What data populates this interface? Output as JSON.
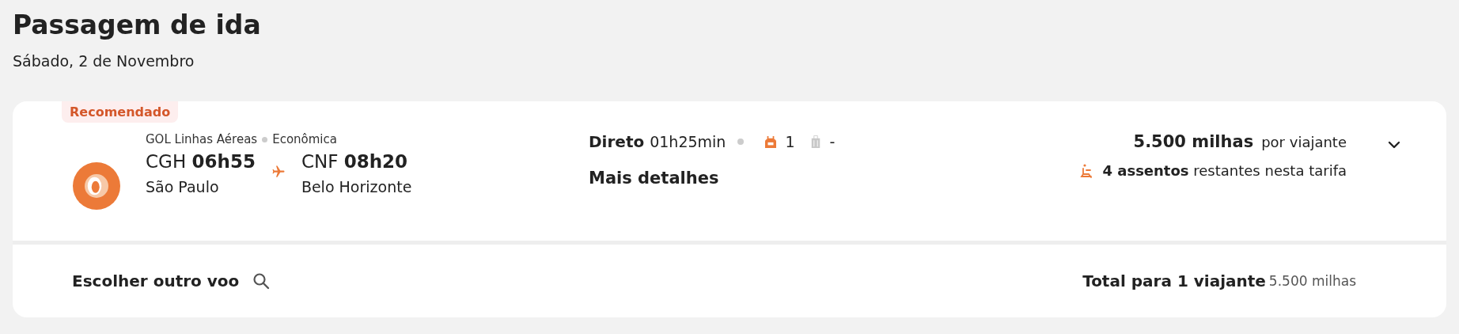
{
  "header": {
    "title": "Passagem de ida",
    "date": "Sábado, 2 de Novembro"
  },
  "flight": {
    "badge": "Recomendado",
    "airline": "GOL Linhas Aéreas",
    "cabin": "Econômica",
    "departure": {
      "code": "CGH",
      "time": "06h55",
      "city": "São Paulo"
    },
    "arrival": {
      "code": "CNF",
      "time": "08h20",
      "city": "Belo Horizonte"
    },
    "stops": "Direto",
    "duration": "01h25min",
    "bags": [
      {
        "kind": "backpack",
        "included": true,
        "count": "1"
      },
      {
        "kind": "suitcase",
        "included": false,
        "count": "-"
      }
    ],
    "details_link": "Mais detalhes",
    "price": "5.500 milhas",
    "price_unit": "por viajante",
    "seats": "**4 assentos** restantes nesta tarifa",
    "expanded": false
  },
  "footer": {
    "other_flight": "Escolher outro voo",
    "total_label": "Total para 1 viajante",
    "total_value": "5.500 milhas"
  }
}
